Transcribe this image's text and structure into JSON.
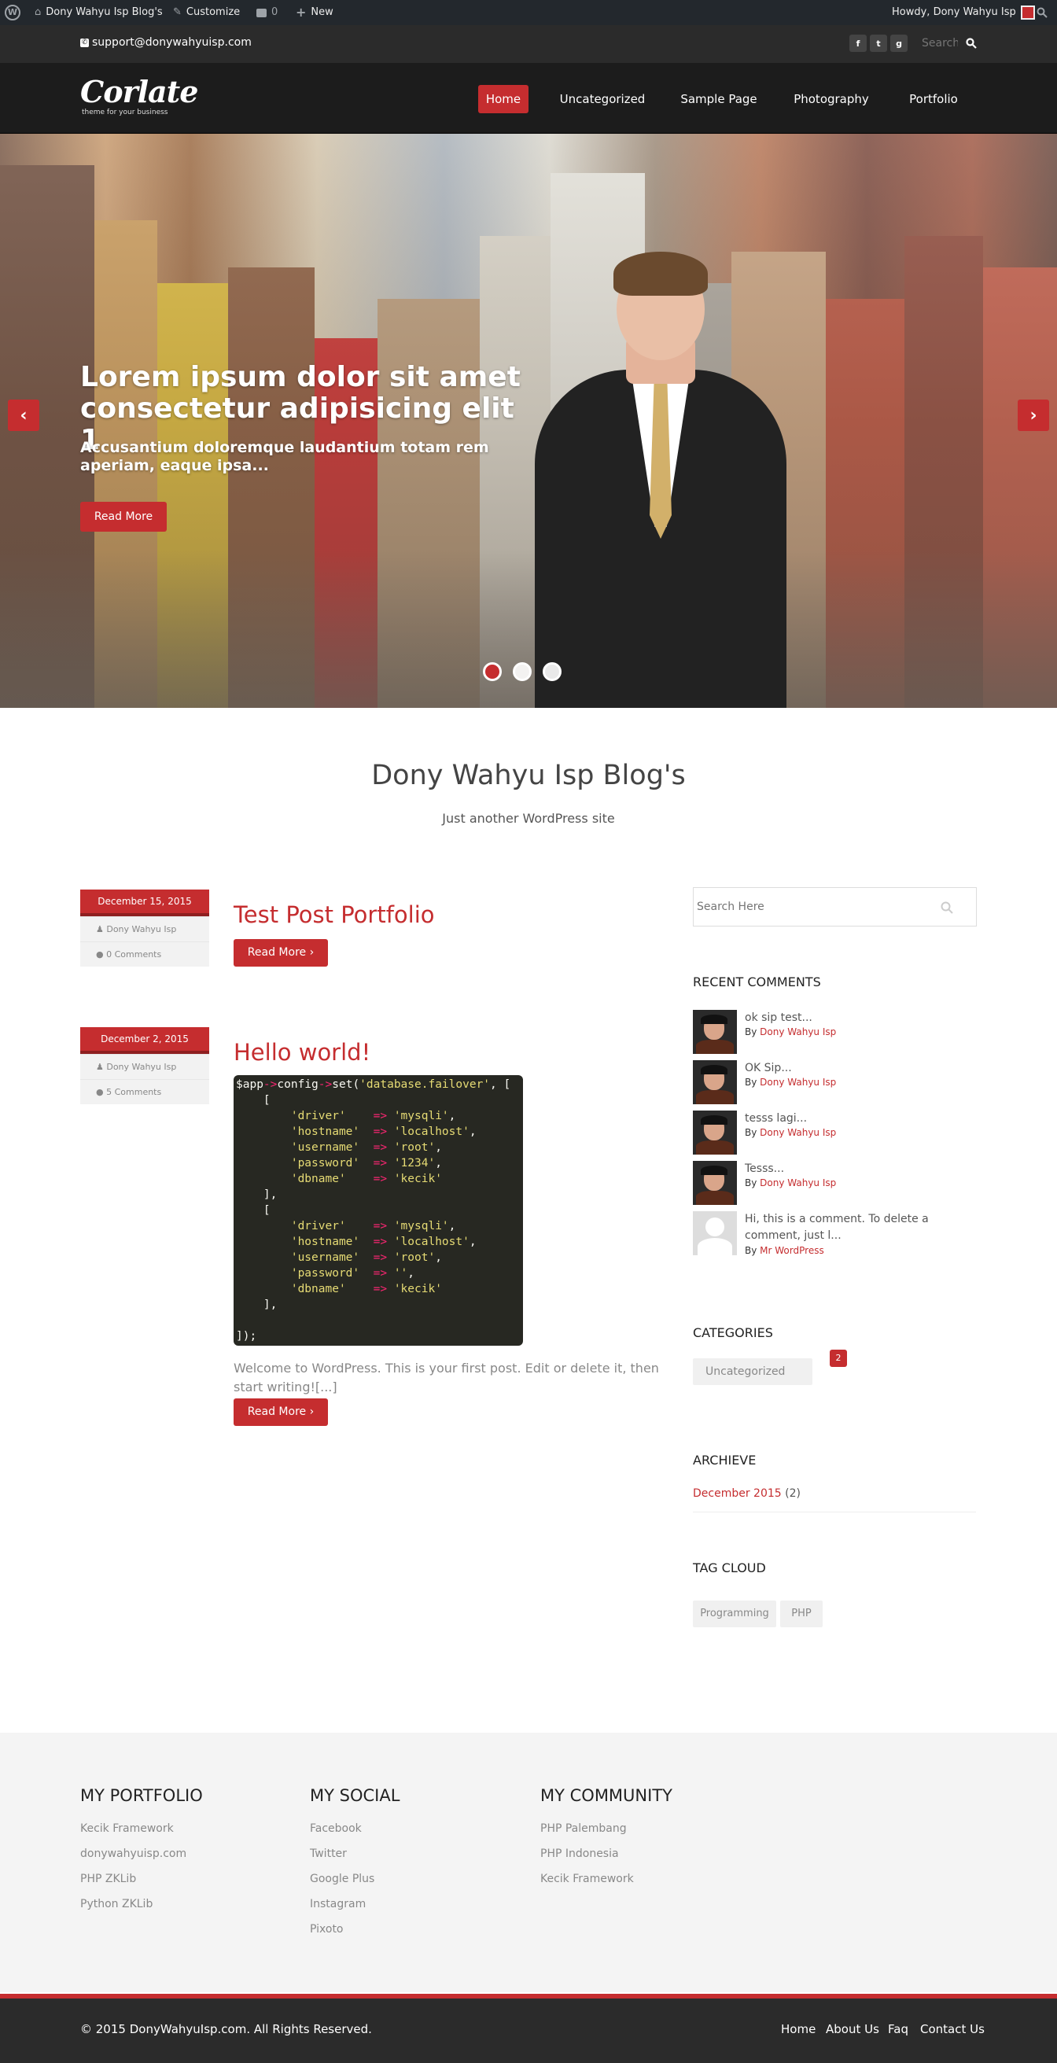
{
  "admin_bar": {
    "site_name": "Dony Wahyu Isp Blog's",
    "customize": "Customize",
    "comments_count": "0",
    "new": "New",
    "howdy": "Howdy, Dony Wahyu Isp"
  },
  "topbar": {
    "email": "support@donywahyuisp.com",
    "social": [
      "f",
      "t",
      "g"
    ],
    "search_placeholder": "Search"
  },
  "header": {
    "logo": "Corlate",
    "tagline": "theme for your business",
    "nav": [
      "Home",
      "Uncategorized",
      "Sample Page",
      "Photography",
      "Portfolio"
    ]
  },
  "slider": {
    "title": "Lorem ipsum dolor sit amet consectetur adipisicing elit 1",
    "subtitle": "Accusantium doloremque laudantium totam rem aperiam, eaque ipsa...",
    "button": "Read More",
    "prev": "‹",
    "next": "›",
    "active_slide": 1,
    "slide_count": 3
  },
  "blog": {
    "title": "Dony Wahyu Isp Blog's",
    "description": "Just another WordPress site"
  },
  "posts": [
    {
      "date": "December 15, 2015",
      "author": "Dony Wahyu Isp",
      "comments": "0 Comments",
      "title": "Test Post Portfolio",
      "read_more": "Read More ›"
    },
    {
      "date": "December 2, 2015",
      "author": "Dony Wahyu Isp",
      "comments": "5 Comments",
      "title": "Hello world!",
      "excerpt": "Welcome to WordPress. This is your first post. Edit or delete it, then start writing![...]",
      "read_more": "Read More ›"
    }
  ],
  "sidebar": {
    "search_placeholder": "Search Here",
    "recent_comments_title": "RECENT COMMENTS",
    "by_label": "By",
    "comments": [
      {
        "text": "ok sip test...",
        "author": "Dony Wahyu Isp"
      },
      {
        "text": "OK Sip...",
        "author": "Dony Wahyu Isp"
      },
      {
        "text": "tesss lagi...",
        "author": "Dony Wahyu Isp"
      },
      {
        "text": "Tesss...",
        "author": "Dony Wahyu Isp"
      },
      {
        "text": "Hi, this is a comment. To delete a comment, just l...",
        "author": "Mr WordPress"
      }
    ],
    "categories_title": "CATEGORIES",
    "category": "Uncategorized",
    "category_count": "2",
    "archive_title": "ARCHIEVE",
    "archive_link": "December 2015",
    "archive_count": "(2)",
    "tagcloud_title": "TAG CLOUD",
    "tags": [
      "Programming",
      "PHP"
    ]
  },
  "footer": {
    "col1_title": "MY PORTFOLIO",
    "col1": [
      "Kecik Framework",
      "donywahyuisp.com",
      "PHP ZKLib",
      "Python ZKLib"
    ],
    "col2_title": "MY SOCIAL",
    "col2": [
      "Facebook",
      "Twitter",
      "Google Plus",
      "Instagram",
      "Pixoto"
    ],
    "col3_title": "MY COMMUNITY",
    "col3": [
      "PHP Palembang",
      "PHP Indonesia",
      "Kecik Framework"
    ]
  },
  "bottom": {
    "copyright": "© 2015 DonyWahyuIsp.com. All Rights Reserved.",
    "links": [
      "Home",
      "About Us",
      "Faq",
      "Contact Us"
    ]
  },
  "colors": {
    "accent": "#c52d2f",
    "dark": "#1c1c1c"
  }
}
